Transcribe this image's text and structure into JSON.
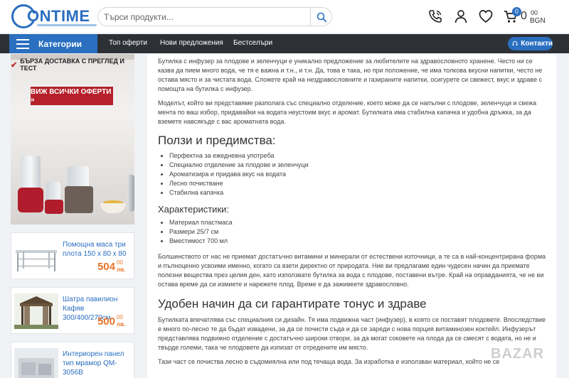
{
  "header": {
    "logo_text": "ONTIME",
    "search": {
      "placeholder": "Търси продукти..."
    },
    "cart": {
      "count": "0",
      "total": "0",
      "cents": "00",
      "currency": "BGN"
    }
  },
  "nav": {
    "categories_label": "Категории",
    "links": [
      "Топ оферти",
      "Нови предложения",
      "Бестселъри"
    ],
    "contacts_label": "Контакти"
  },
  "sidebar": {
    "banner_line": "БЪРЗА ДОСТАВКА С ПРЕГЛЕД И ТЕСТ",
    "offers_button": "ВИЖ ВСИЧКИ ОФЕРТИ »",
    "products": [
      {
        "name": "Помощна маса три плота 150 х 80 х 80",
        "price": "504",
        "cents": "00",
        "currency": "лв."
      },
      {
        "name": "Шатра павилион Кафяв 300/400/270см",
        "price": "500",
        "cents": "00",
        "currency": "лв."
      },
      {
        "name": "Интериорен панел тип мрамор QM-3056B",
        "price": "",
        "cents": "",
        "currency": ""
      }
    ]
  },
  "content": {
    "p1": "Бутилка с инфузер за плодове и зеленчуци е уникално предложение за любителите на здравословното хранене. Често ни се казва да пием много вода, че тя е важна и т.н., и т.н. Да, това е така, но при положение, че има толкова вкусни напитки, често не остава място и за чистата вода. Сложете край на нездравословните и газираните напитки, осигурете си свежест, вкус и здраве с помощта на бутилка с инфузер.",
    "p2": "Моделът, който ви представяме разполага със специално отделение, което може да се напълни с плодове, зеленчуци и свежа мента по ваш избор, придавайки на водата неустоим вкус и аромат. Бутилката има стабилна капачка и удобна дръжка, за да вземете навсякъде с вас ароматната вода.",
    "h_benefits": "Ползи и предимства:",
    "benefits": [
      "Перфектна за ежедневна употреба",
      "Специално отделение за плодове и зеленчуци",
      "Ароматизира и придава вкус на водата",
      "Лесно почистване",
      "Стабилна капачка"
    ],
    "h_specs": "Характеристики:",
    "specs": [
      "Материал пластмаса",
      "Размери 25/7 см",
      "Вместимост 700 мл"
    ],
    "p3": "Болшинството от нас не приемат достатъчно витамини и минерали от естествени източници, а те са в най-концентрирана форма и пълноценно усвоими именно, когато са взети директно от природата. Ние ви предлагаме един чудесен начин да приемате полезни вещества през целия ден, като използвате бутилка за вода с плодове, поставени вътре. Край на оправданията, че не ви остава време да си измиете и нарежете плод. Време е да заживеете здравословно.",
    "h_tonus": "Удобен начин да си гарантирате тонус и здраве",
    "p4": "Бутилката впечатлява със специалния си дизайн. Тя има подвижна част (инфузер), в която се поставят плодовете. Впоследствие е много по-лесно те да бъдат извадени, за да се почисти съда и да се зареди с нова порция витаминозен коктейл. Инфузерът представлява подвижно отделение с достатъчно широки отвори, за да могат соковете на плода да се смесят с водата, но не и твърде големи, така че плодовете да изпизат от отредените им място.",
    "p5": "Тази част се почиства лесно в съдомиялна или под течаща вода. За изработка е използван материал, който не се"
  },
  "watermark": "BAZAR"
}
